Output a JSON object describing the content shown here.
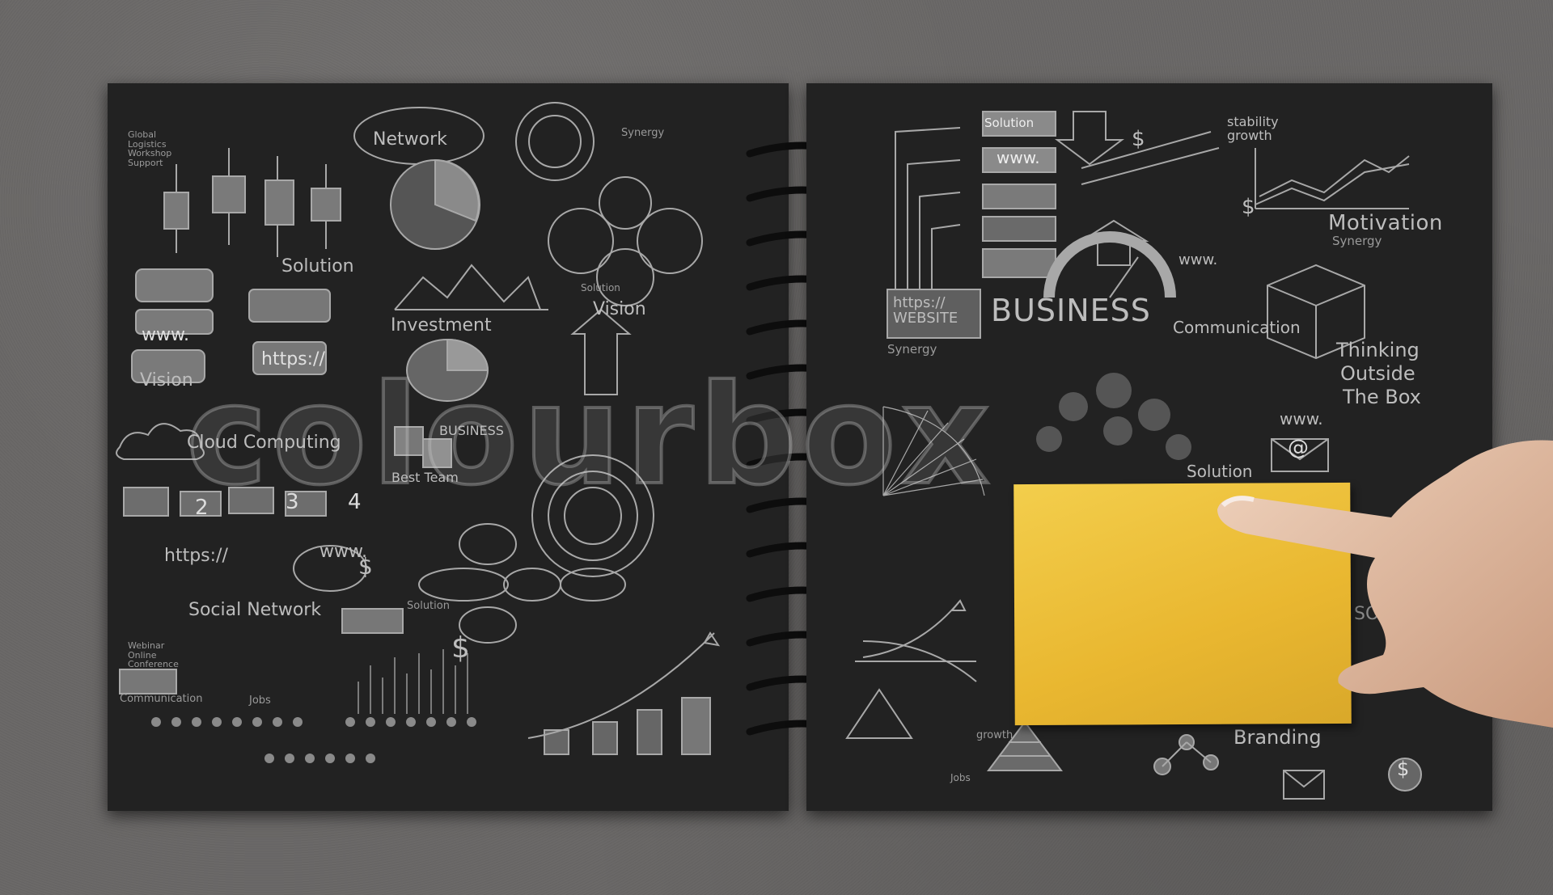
{
  "watermark": "colourbox",
  "left_page": {
    "labels": {
      "network": "Network",
      "solution": "Solution",
      "vision1": "Vision",
      "vision2": "Vision",
      "investment": "Investment",
      "cloud": "Cloud Computing",
      "www1": "www.",
      "www2": "www.",
      "https1": "https://",
      "https2": "https://",
      "https3": "https://",
      "social": "Social Network",
      "best_team": "Best Team",
      "communication": "Communication",
      "jobs": "Jobs",
      "synergy": "Synergy",
      "business": "BUSINESS",
      "solution2": "Solution",
      "solution3": "Solution",
      "numbers": [
        "2",
        "3",
        "4"
      ],
      "global_logistics": "Global Logistics Workshop Support",
      "webinar": "Webinar Online Conference"
    }
  },
  "right_page": {
    "labels": {
      "solution": "Solution",
      "www1": "www.",
      "stability": "stability growth",
      "motivation": "Motivation",
      "synergy": "Synergy",
      "business": "BUSINESS",
      "https_website": "https:// WEBSITE",
      "communication": "Communication",
      "thinking": [
        "Thinking",
        "Outside",
        "The Box"
      ],
      "www2": "www.",
      "www3": "www.",
      "solution2": "Solution",
      "social_media": "SOCIAL MEDIA",
      "branding": "Branding",
      "synergy2": "Synergy",
      "growth": "growth",
      "jobs": "Jobs"
    }
  },
  "colors": {
    "background": "#6b6968",
    "page": "#222222",
    "sticky_note": "#f0c640",
    "chalk": "#bdbdbd",
    "skin": "#e6c3aa"
  },
  "icons": [
    "dollar-icon",
    "star-icon",
    "envelope-icon",
    "person-icon",
    "arrow-icon",
    "puzzle-icon"
  ]
}
